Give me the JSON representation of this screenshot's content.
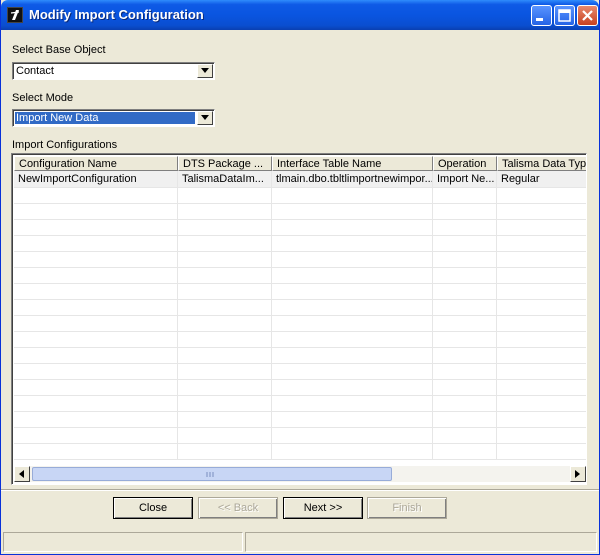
{
  "window": {
    "title": "Modify Import Configuration",
    "icon": "talisma-app-icon"
  },
  "titlebar_buttons": [
    "minimize-icon",
    "maximize-icon",
    "close-icon"
  ],
  "base_object": {
    "label": "Select Base Object",
    "value": "Contact"
  },
  "mode": {
    "label": "Select Mode",
    "value": "Import New Data"
  },
  "import_configurations": {
    "label": "Import Configurations",
    "columns": [
      "Configuration Name",
      "DTS Package ...",
      "Interface Table Name",
      "Operation",
      "Talisma Data Type"
    ],
    "rows": [
      [
        "NewImportConfiguration",
        "TalismaDataIm...",
        "tlmain.dbo.tbltlimportnewimpor...",
        "Import Ne...",
        "Regular"
      ]
    ],
    "scrollbar_grip": "|||"
  },
  "buttons": {
    "close": "Close",
    "back": "<< Back",
    "next": "Next >>",
    "finish": "Finish"
  },
  "colors": {
    "title_bar": "#0a55e0",
    "window_bg": "#ece9d8",
    "selection": "#316ac5"
  }
}
